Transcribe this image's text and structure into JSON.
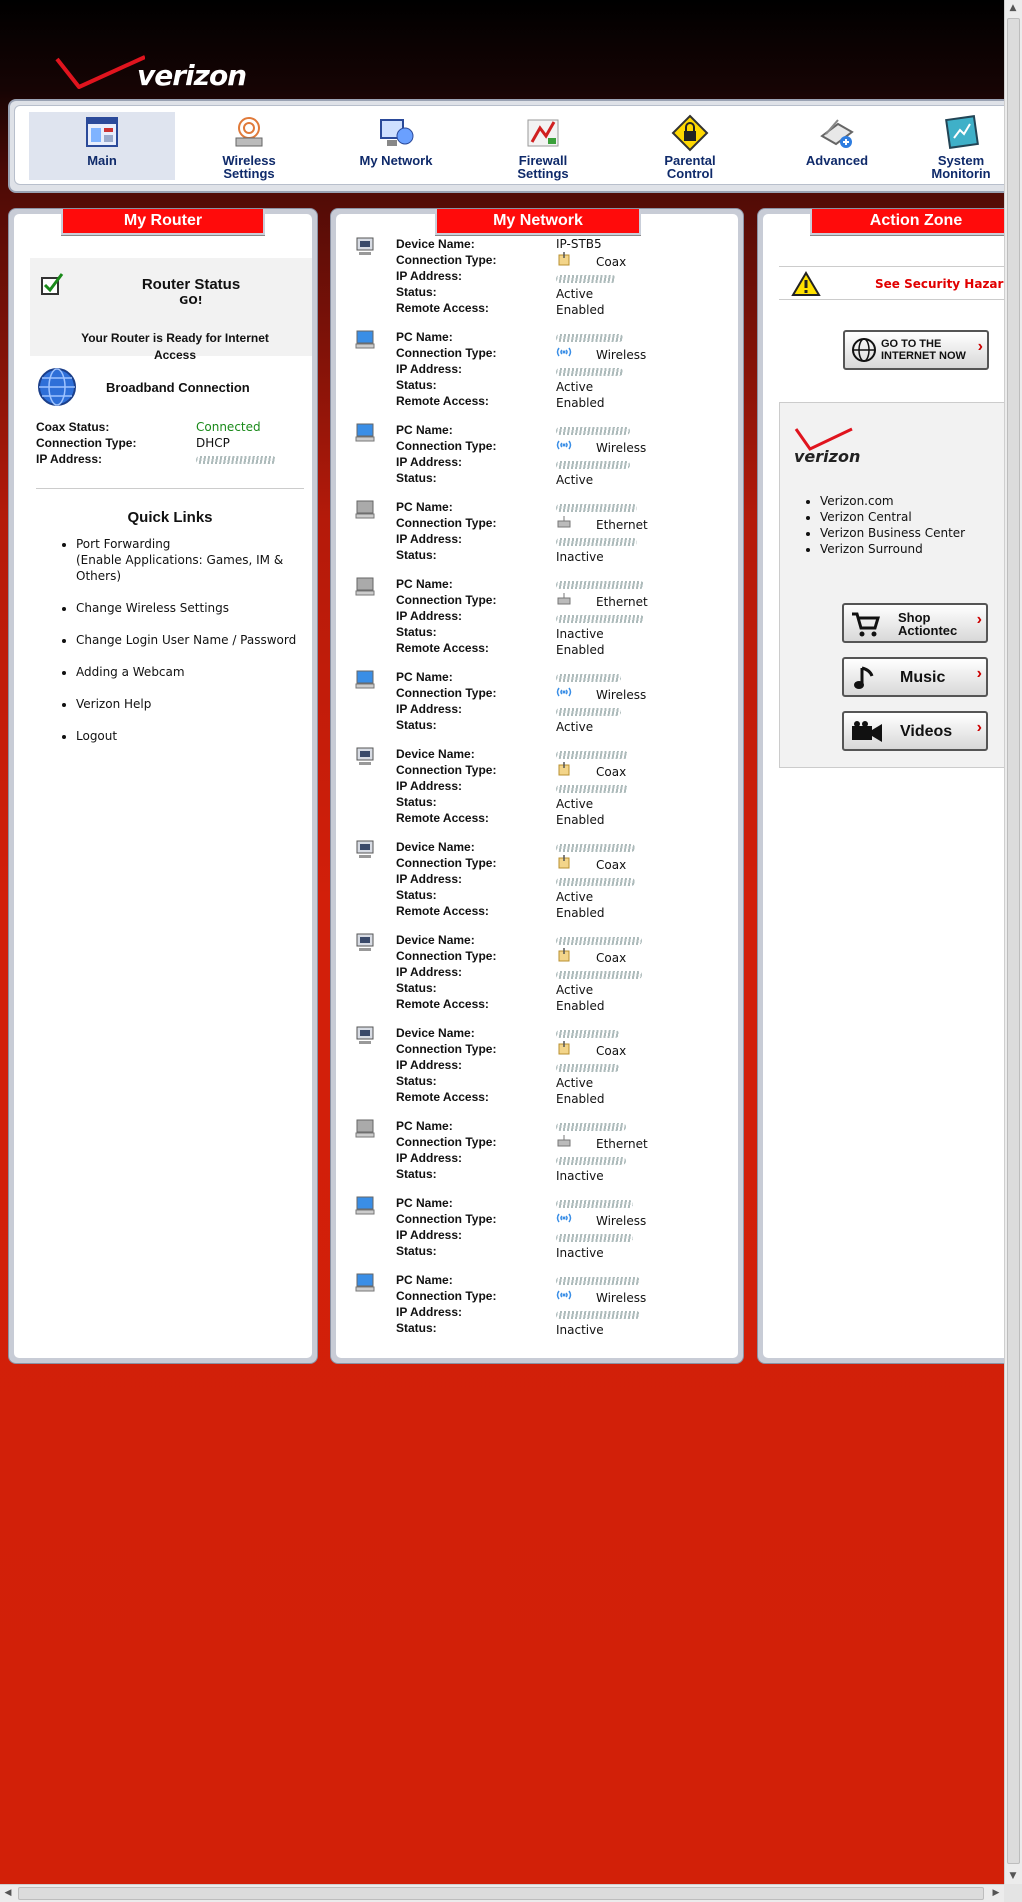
{
  "brand": {
    "logo_text": "verizon"
  },
  "nav": {
    "items": [
      {
        "label": "Main"
      },
      {
        "label": "Wireless\nSettings"
      },
      {
        "label": "My Network"
      },
      {
        "label": "Firewall\nSettings"
      },
      {
        "label": "Parental\nControl"
      },
      {
        "label": "Advanced"
      },
      {
        "label": "System\nMonitorin"
      }
    ]
  },
  "my_router": {
    "title": "My Router",
    "router_status": "Router Status",
    "go": "GO!",
    "ready": "Your Router is Ready for Internet Access",
    "broadband": "Broadband Connection",
    "coax_status_label": "Coax Status:",
    "coax_status_value": "Connected",
    "connection_type_label": "Connection Type:",
    "connection_type_value": "DHCP",
    "ip_label": "IP Address:",
    "quick_links_title": "Quick Links",
    "quick_links": [
      "Port Forwarding",
      "(Enable Applications: Games, IM & Others)",
      "Change Wireless Settings",
      "Change Login User Name / Password",
      "Adding a Webcam",
      "Verizon Help",
      "Logout"
    ]
  },
  "my_network": {
    "title": "My Network",
    "labels": {
      "device_name": "Device Name:",
      "pc_name": "PC Name:",
      "connection_type": "Connection Type:",
      "ip_address": "IP Address:",
      "status": "Status:",
      "remote_access": "Remote Access:"
    },
    "devices": [
      {
        "kind": "device",
        "name": "IP-STB5",
        "conn": "Coax",
        "status": "Active",
        "remote": "Enabled"
      },
      {
        "kind": "pc",
        "conn": "Wireless",
        "status": "Active",
        "remote": "Enabled"
      },
      {
        "kind": "pc",
        "conn": "Wireless",
        "status": "Active"
      },
      {
        "kind": "pc",
        "conn": "Ethernet",
        "status": "Inactive"
      },
      {
        "kind": "pc",
        "conn": "Ethernet",
        "status": "Inactive",
        "remote": "Enabled"
      },
      {
        "kind": "pc",
        "conn": "Wireless",
        "status": "Active"
      },
      {
        "kind": "device",
        "conn": "Coax",
        "status": "Active",
        "remote": "Enabled"
      },
      {
        "kind": "device",
        "conn": "Coax",
        "status": "Active",
        "remote": "Enabled"
      },
      {
        "kind": "device",
        "conn": "Coax",
        "status": "Active",
        "remote": "Enabled"
      },
      {
        "kind": "device",
        "conn": "Coax",
        "status": "Active",
        "remote": "Enabled"
      },
      {
        "kind": "pc",
        "conn": "Ethernet",
        "status": "Inactive"
      },
      {
        "kind": "pc",
        "conn": "Wireless",
        "status": "Inactive"
      },
      {
        "kind": "pc",
        "conn": "Wireless",
        "status": "Inactive"
      }
    ]
  },
  "action_zone": {
    "title": "Action Zone",
    "hazard": "See Security Hazard",
    "internet_button": "GO TO THE INTERNET NOW",
    "links": [
      "Verizon.com",
      "Verizon Central",
      "Verizon Business Center",
      "Verizon Surround"
    ],
    "shop_button": "Shop Actiontec",
    "music_button": "Music",
    "videos_button": "Videos"
  },
  "colors": {
    "accent_red": "#ff0b0b",
    "connected_green": "#008000",
    "hazard_red": "#e10000",
    "nav_text": "#0f2a6a"
  }
}
